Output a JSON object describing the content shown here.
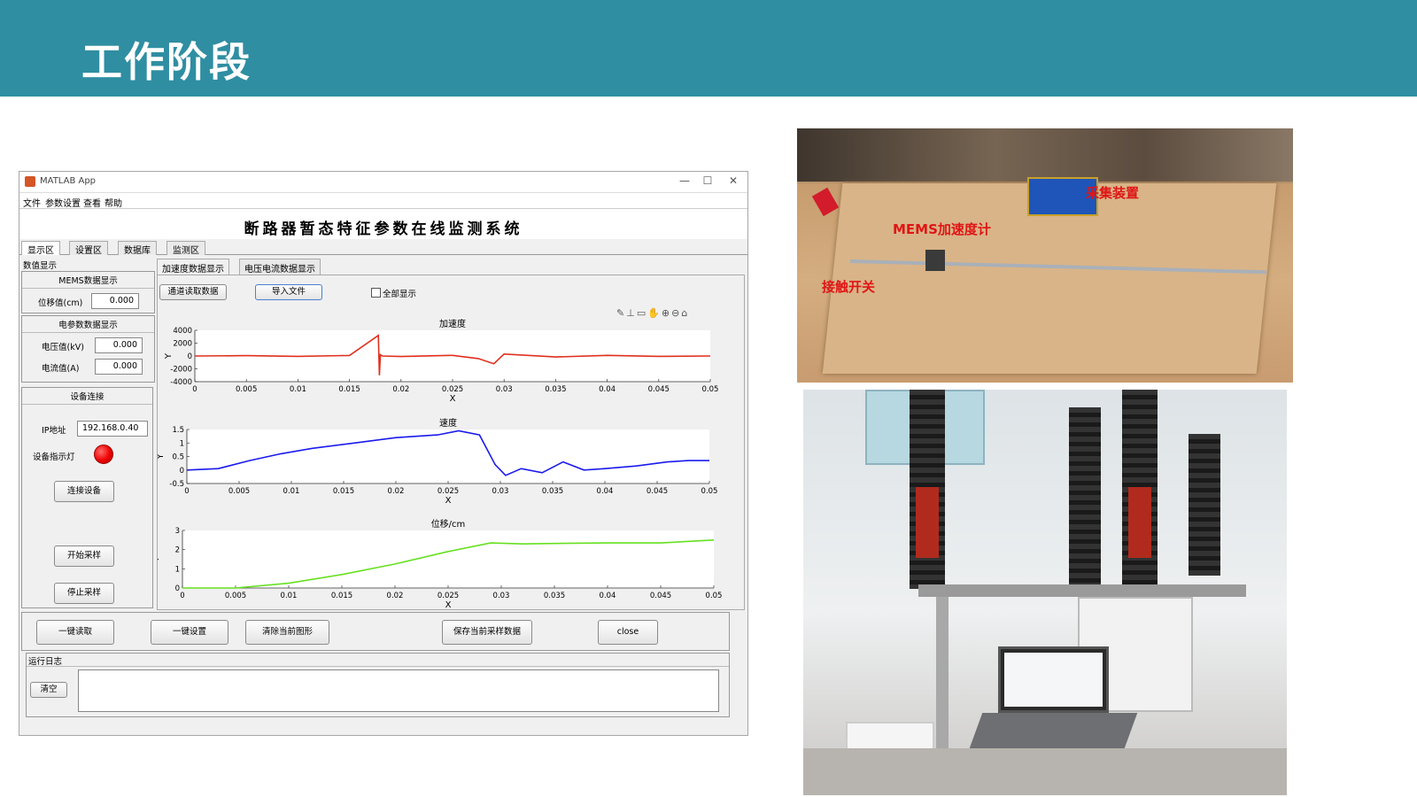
{
  "slide": {
    "title": "工作阶段"
  },
  "window": {
    "title": "MATLAB App",
    "controls": {
      "minimize": "—",
      "maximize": "☐",
      "close": "✕"
    },
    "menu": [
      "文件",
      "参数设置",
      "查看",
      "帮助"
    ],
    "system_title": "断路器暂态特征参数在线监测系统",
    "tabs": [
      "显示区",
      "设置区",
      "数据库",
      "监测区"
    ],
    "left": {
      "section": "数值显示",
      "mems_title": "MEMS数据显示",
      "displacement_label": "位移值(cm)",
      "displacement_value": "0.000",
      "elec_title": "电参数数据显示",
      "voltage_label": "电压值(kV)",
      "voltage_value": "0.000",
      "current_label": "电流值(A)",
      "current_value": "0.000",
      "conn_title": "设备连接",
      "ip_label": "IP地址",
      "ip_value": "192.168.0.40",
      "led_label": "设备指示灯",
      "connect_btn": "连接设备",
      "start_btn": "开始采样",
      "stop_btn": "停止采样"
    },
    "right": {
      "subtabs": [
        "加速度数据显示",
        "电压电流数据显示"
      ],
      "channel_btn": "通道读取数据",
      "import_btn": "导入文件",
      "show_all_label": "全部显示"
    },
    "bottom": {
      "read_btn": "一键读取",
      "setup_btn": "一键设置",
      "clear_fig_btn": "清除当前图形",
      "save_btn": "保存当前采样数据",
      "close_btn": "close",
      "log_title": "运行日志",
      "clear_btn": "清空"
    }
  },
  "chart_data": [
    {
      "type": "line",
      "title": "加速度",
      "xlabel": "X",
      "ylabel": "Y",
      "xlim": [
        0,
        0.05
      ],
      "ylim": [
        -4000,
        4000
      ],
      "x_ticks": [
        "0",
        "0.005",
        "0.01",
        "0.015",
        "0.02",
        "0.025",
        "0.03",
        "0.035",
        "0.04",
        "0.045",
        "0.05"
      ],
      "y_ticks": [
        "4000",
        "2000",
        "0",
        "-2000",
        "-4000"
      ],
      "color": "#e0301e",
      "x": [
        0,
        0.005,
        0.01,
        0.015,
        0.0178,
        0.0179,
        0.018,
        0.0182,
        0.02,
        0.025,
        0.0275,
        0.029,
        0.03,
        0.035,
        0.04,
        0.045,
        0.05
      ],
      "y": [
        0,
        50,
        -60,
        80,
        3200,
        -3000,
        200,
        0,
        -80,
        100,
        -400,
        -1200,
        300,
        -150,
        100,
        -50,
        0
      ]
    },
    {
      "type": "line",
      "title": "速度",
      "xlabel": "X",
      "ylabel": "Y",
      "xlim": [
        0,
        0.05
      ],
      "ylim": [
        -0.5,
        1.5
      ],
      "x_ticks": [
        "0",
        "0.005",
        "0.01",
        "0.015",
        "0.02",
        "0.025",
        "0.03",
        "0.035",
        "0.04",
        "0.045",
        "0.05"
      ],
      "y_ticks": [
        "1.5",
        "1",
        "0.5",
        "0",
        "-0.5"
      ],
      "color": "#1a1aee",
      "x": [
        0,
        0.003,
        0.006,
        0.009,
        0.012,
        0.016,
        0.02,
        0.024,
        0.026,
        0.028,
        0.0295,
        0.0305,
        0.032,
        0.034,
        0.036,
        0.038,
        0.04,
        0.043,
        0.046,
        0.048,
        0.05
      ],
      "y": [
        0,
        0.05,
        0.35,
        0.6,
        0.8,
        1.0,
        1.2,
        1.3,
        1.45,
        1.3,
        0.2,
        -0.2,
        0.05,
        -0.1,
        0.3,
        0.0,
        0.05,
        0.15,
        0.3,
        0.35,
        0.35
      ]
    },
    {
      "type": "line",
      "title": "位移/cm",
      "xlabel": "X",
      "ylabel": "Y",
      "xlim": [
        0,
        0.05
      ],
      "ylim": [
        0,
        3
      ],
      "x_ticks": [
        "0",
        "0.005",
        "0.01",
        "0.015",
        "0.02",
        "0.025",
        "0.03",
        "0.035",
        "0.04",
        "0.045",
        "0.05"
      ],
      "y_ticks": [
        "3",
        "2",
        "1",
        "0"
      ],
      "color": "#66e020",
      "x": [
        0,
        0.005,
        0.01,
        0.015,
        0.02,
        0.025,
        0.029,
        0.032,
        0.035,
        0.04,
        0.045,
        0.05
      ],
      "y": [
        0,
        0,
        0.25,
        0.7,
        1.25,
        1.9,
        2.35,
        2.3,
        2.32,
        2.35,
        2.35,
        2.5
      ]
    }
  ],
  "photos": {
    "bench_labels": [
      "采集装置",
      "MEMS加速度计",
      "接触开关"
    ]
  }
}
